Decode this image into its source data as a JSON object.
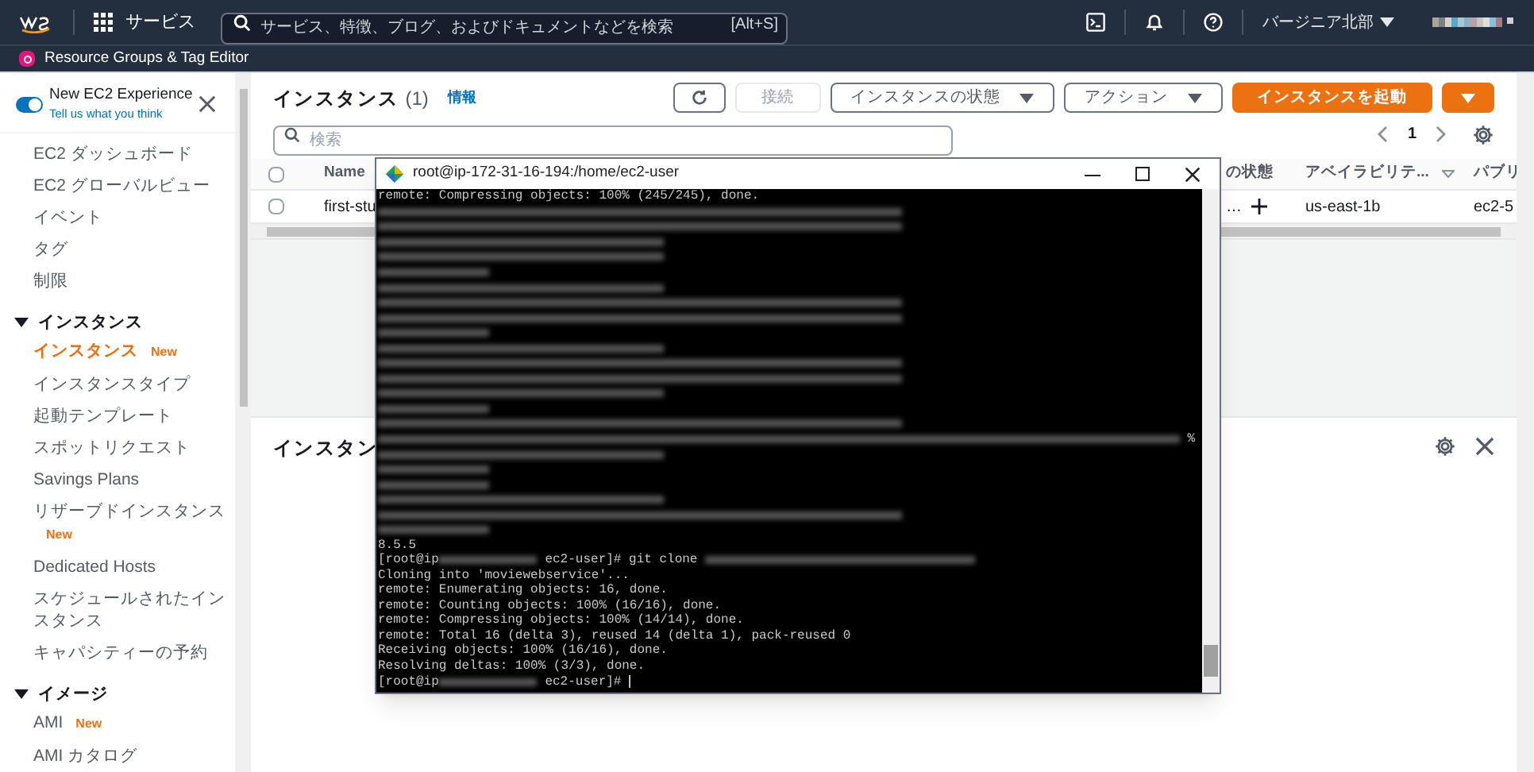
{
  "top_nav": {
    "services": "サービス",
    "search": {
      "placeholder": "サービス、特徴、ブログ、およびドキュメントなどを検索",
      "shortcut": "[Alt+S]"
    },
    "region": "バージニア北部"
  },
  "service_bar": {
    "label": "Resource Groups & Tag Editor"
  },
  "sidebar": {
    "experience": {
      "label": "New EC2 Experience",
      "on": true,
      "link": "Tell us what you think"
    },
    "items": [
      {
        "label": "EC2 ダッシュボード",
        "selected": false
      },
      {
        "label": "EC2 グローバルビュー",
        "selected": false
      },
      {
        "label": "イベント",
        "selected": false
      },
      {
        "label": "タグ",
        "selected": false
      },
      {
        "label": "制限",
        "selected": false
      }
    ],
    "sections": [
      {
        "label": "インスタンス",
        "expanded": true,
        "items": [
          {
            "label": "インスタンス",
            "selected": true,
            "badge": "New"
          },
          {
            "label": "インスタンスタイプ",
            "selected": false
          },
          {
            "label": "起動テンプレート",
            "selected": false
          },
          {
            "label": "スポットリクエスト",
            "selected": false
          },
          {
            "label": "Savings Plans",
            "selected": false
          },
          {
            "label": "リザーブドインスタンス",
            "selected": false,
            "badge": "New"
          },
          {
            "label": "Dedicated Hosts",
            "selected": false
          },
          {
            "label": "スケジュールされたインスタンス",
            "selected": false
          },
          {
            "label": "キャパシティーの予約",
            "selected": false
          }
        ]
      },
      {
        "label": "イメージ",
        "expanded": true,
        "items": [
          {
            "label": "AMI",
            "selected": false,
            "badge": "New"
          },
          {
            "label": "AMI カタログ",
            "selected": false
          }
        ]
      }
    ]
  },
  "main": {
    "title": "インスタンス",
    "count": "(1)",
    "info": "情報",
    "buttons": [
      {
        "kind": "refresh"
      },
      {
        "kind": "text",
        "label": "接続",
        "disabled": true
      },
      {
        "kind": "dropdown",
        "label": "インスタンスの状態"
      },
      {
        "kind": "dropdown",
        "label": "アクション"
      },
      {
        "kind": "primary",
        "label": "インスタンスを起動"
      },
      {
        "kind": "primary-caret"
      }
    ],
    "search": {
      "placeholder": "検索"
    },
    "page": "1",
    "table": {
      "all_checked": false,
      "columns": [
        "Name",
        "の状態",
        "アベイラビリテ...",
        "パブリ"
      ],
      "rows": [
        {
          "checked": false,
          "cells": [
            "first-stu",
            "…",
            "us-east-1b",
            "ec2-5"
          ]
        }
      ]
    },
    "details": {
      "title": "インスタン"
    }
  },
  "terminal": {
    "title": "root@ip-172-31-16-194:/home/ec2-user",
    "lines": [
      [
        {
          "kind": "text",
          "text": "remote: Compressing objects: 100% (245/245), done."
        }
      ],
      [
        {
          "kind": "blur"
        }
      ],
      [
        {
          "kind": "blur"
        }
      ],
      [
        {
          "kind": "blur"
        }
      ],
      [
        {
          "kind": "blur"
        }
      ],
      [
        {
          "kind": "blur"
        }
      ],
      [
        {
          "kind": "blur"
        }
      ],
      [
        {
          "kind": "blur"
        }
      ],
      [
        {
          "kind": "blur"
        }
      ],
      [
        {
          "kind": "blur"
        }
      ],
      [
        {
          "kind": "blur"
        }
      ],
      [
        {
          "kind": "blur"
        }
      ],
      [
        {
          "kind": "blur"
        }
      ],
      [
        {
          "kind": "blur"
        }
      ],
      [
        {
          "kind": "blur"
        }
      ],
      [
        {
          "kind": "blur"
        }
      ],
      [
        {
          "kind": "blur"
        },
        {
          "kind": "text",
          "text": " %"
        }
      ],
      [
        {
          "kind": "blur"
        }
      ],
      [
        {
          "kind": "blur"
        }
      ],
      [
        {
          "kind": "blur"
        }
      ],
      [
        {
          "kind": "blur"
        }
      ],
      [
        {
          "kind": "blur"
        }
      ],
      [
        {
          "kind": "blur"
        }
      ],
      [
        {
          "kind": "text",
          "text": "8.5.5"
        }
      ],
      [
        {
          "kind": "text",
          "text": "[root@ip"
        },
        {
          "kind": "blur"
        },
        {
          "kind": "text",
          "text": " ec2-user]# git clone "
        },
        {
          "kind": "blur"
        }
      ],
      [
        {
          "kind": "text",
          "text": "Cloning into 'moviewebservice'..."
        }
      ],
      [
        {
          "kind": "text",
          "text": "remote: Enumerating objects: 16, done."
        }
      ],
      [
        {
          "kind": "text",
          "text": "remote: Counting objects: 100% (16/16), done."
        }
      ],
      [
        {
          "kind": "text",
          "text": "remote: Compressing objects: 100% (14/14), done."
        }
      ],
      [
        {
          "kind": "text",
          "text": "remote: Total 16 (delta 3), reused 14 (delta 1), pack-reused 0"
        }
      ],
      [
        {
          "kind": "text",
          "text": "Receiving objects: 100% (16/16), done."
        }
      ],
      [
        {
          "kind": "text",
          "text": "Resolving deltas: 100% (3/3), done."
        }
      ],
      [
        {
          "kind": "text",
          "text": "[root@ip"
        },
        {
          "kind": "blur"
        },
        {
          "kind": "text",
          "text": " ec2-user]# "
        },
        {
          "kind": "cursor"
        }
      ]
    ]
  }
}
